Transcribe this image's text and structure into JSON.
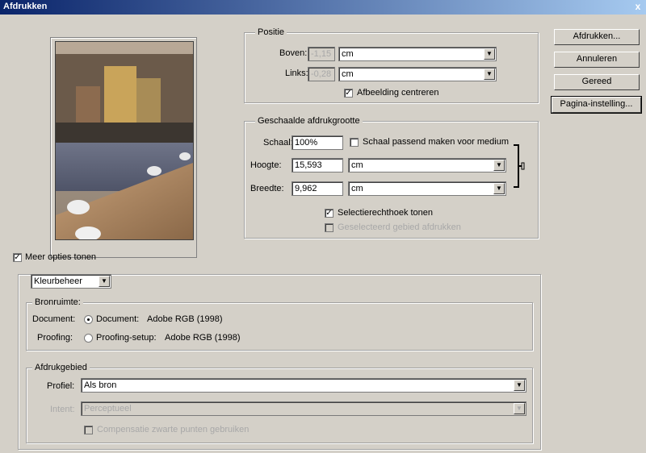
{
  "window": {
    "title": "Afdrukken",
    "close_glyph": "x"
  },
  "buttons": [
    {
      "label": "Afdrukken..."
    },
    {
      "label": "Annuleren"
    },
    {
      "label": "Gereed"
    },
    {
      "label": "Pagina-instelling..."
    }
  ],
  "positie": {
    "legend": "Positie",
    "boven_label": "Boven:",
    "boven_value": "-1,15",
    "boven_unit": "cm",
    "links_label": "Links:",
    "links_value": "-0,28",
    "links_unit": "cm",
    "center_label": "Afbeelding centreren",
    "center_checked": true
  },
  "scaled": {
    "legend": "Geschaalde afdrukgrootte",
    "schaal_label": "Schaal:",
    "schaal_value": "100%",
    "fit_label": "Schaal passend maken voor medium",
    "fit_checked": false,
    "hoogte_label": "Hoogte:",
    "hoogte_value": "15,593",
    "hoogte_unit": "cm",
    "breedte_label": "Breedte:",
    "breedte_value": "9,962",
    "breedte_unit": "cm",
    "link_icon": "chain-link-icon",
    "bbox_label": "Selectierechthoek tonen",
    "bbox_checked": true,
    "print_sel_label": "Geselecteerd gebied afdrukken",
    "print_sel_checked": false
  },
  "more_options": {
    "label": "Meer opties tonen",
    "checked": true
  },
  "options_panel": {
    "mode_select": "Kleurbeheer",
    "bronruimte": {
      "legend": "Bronruimte:",
      "document_label": "Document:",
      "document_radio": "Document:",
      "document_value": "Adobe RGB (1998)",
      "proofing_label": "Proofing:",
      "proofing_radio": "Proofing-setup:",
      "proofing_value": "Adobe RGB (1998)"
    },
    "afdrukgebied": {
      "legend": "Afdrukgebied",
      "profiel_label": "Profiel:",
      "profiel_value": "Als bron",
      "intent_label": "Intent:",
      "intent_value": "Perceptueel",
      "bpc_label": "Compensatie zwarte punten gebruiken",
      "bpc_checked": false
    }
  },
  "colors": {
    "face": "#d4d0c8",
    "title_start": "#0a246a",
    "title_end": "#a6caf0"
  }
}
